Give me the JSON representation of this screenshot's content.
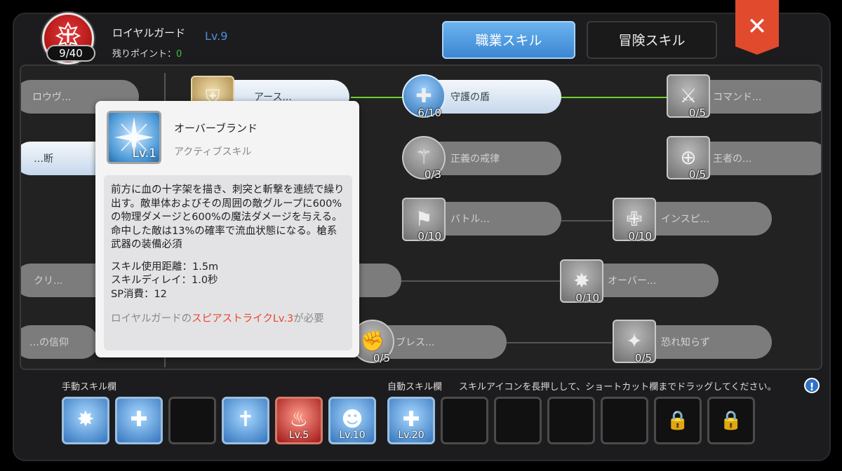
{
  "header": {
    "sp_count": "9/40",
    "job_name": "ロイヤルガード",
    "job_level": "Lv.9",
    "points_label": "残りポイント：",
    "points_value": "0",
    "tab_job": "職業スキル",
    "tab_adventure": "冒険スキル",
    "close_glyph": "✕"
  },
  "tree": {
    "skills": [
      {
        "name": "ロウヴ...",
        "level": ""
      },
      {
        "name": "アース...",
        "level": ""
      },
      {
        "name": "守護の盾",
        "level": "6/10"
      },
      {
        "name": "コマンド...",
        "level": "0/5"
      },
      {
        "name": "…断",
        "level": ""
      },
      {
        "name": "正義の戒律",
        "level": "0/3"
      },
      {
        "name": "王者の...",
        "level": "0/5"
      },
      {
        "name": "バトル...",
        "level": "0/10"
      },
      {
        "name": "インスピ...",
        "level": "0/10"
      },
      {
        "name": "クリ...",
        "level": ""
      },
      {
        "name": "オーバー...",
        "level": "0/10"
      },
      {
        "name": "…の信仰",
        "level": ""
      },
      {
        "name": "ブレス...",
        "level": "0/5"
      },
      {
        "name": "恐れ知らず",
        "level": "0/5"
      }
    ]
  },
  "tooltip": {
    "icon_level": "Lv.1",
    "title": "オーバーブランド",
    "type": "アクティブスキル",
    "description": "前方に血の十字架を描き、刺突と斬撃を連続で繰り出す。敵単体およびその周囲の敵グループに600%の物理ダメージと600%の魔法ダメージを与える。命中した敵は13%の確率で流血状態になる。槍系武器の装備必須",
    "stat_range": "スキル使用距離：1.5m",
    "stat_delay": "スキルディレイ：1.0秒",
    "stat_sp": "SP消費：12",
    "req_prefix": "ロイヤルガードの",
    "req_highlight": "スピアストライクLv.3",
    "req_suffix": "が必要"
  },
  "bottom": {
    "manual_label": "手動スキル欄",
    "auto_label": "自動スキル欄",
    "hint": "スキルアイコンを長押しして、ショートカット欄までドラッグしてください。",
    "info_glyph": "!",
    "manual_slots": [
      {
        "icon": "sword-burst-icon",
        "glyph": "✸",
        "level": ""
      },
      {
        "icon": "revive-icon",
        "glyph": "✚",
        "level": ""
      },
      {
        "icon": "empty-slot",
        "glyph": "",
        "level": ""
      },
      {
        "icon": "holy-cross-icon",
        "glyph": "✝",
        "level": ""
      },
      {
        "icon": "fire-aura-icon",
        "glyph": "♨",
        "level": "Lv.5"
      },
      {
        "icon": "power-up-icon",
        "glyph": "☻",
        "level": "Lv.10"
      }
    ],
    "auto_slots": [
      {
        "icon": "guardian-shield-icon",
        "glyph": "✚",
        "level": "Lv.20"
      },
      {
        "icon": "empty-slot",
        "glyph": "",
        "level": ""
      },
      {
        "icon": "empty-slot",
        "glyph": "",
        "level": ""
      },
      {
        "icon": "empty-slot",
        "glyph": "",
        "level": ""
      },
      {
        "icon": "empty-slot",
        "glyph": "",
        "level": ""
      },
      {
        "icon": "lock-icon",
        "glyph": "🔒",
        "level": ""
      },
      {
        "icon": "lock-icon",
        "glyph": "🔒",
        "level": ""
      }
    ]
  },
  "colors": {
    "accent_blue": "#3b86d2",
    "close_red": "#e24a2e",
    "points_green": "#3ec23e",
    "highlight_red": "#e8472a"
  }
}
